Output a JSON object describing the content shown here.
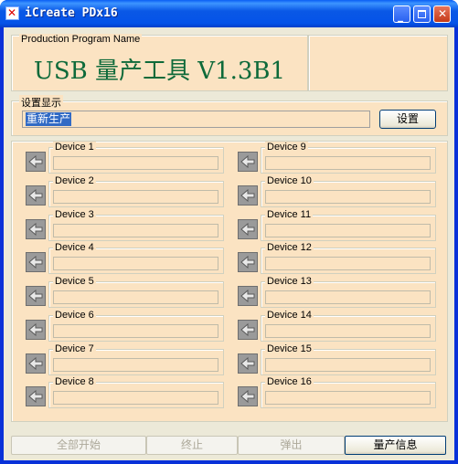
{
  "window": {
    "title": "iCreate PDx16"
  },
  "header": {
    "group_label": "Production Program Name",
    "program_name": "USB 量产工具 V1.3B1"
  },
  "settings": {
    "group_label": "设置显示",
    "status_text": "重新生产",
    "settings_button": "设置"
  },
  "devices_left": [
    {
      "label": "Device 1"
    },
    {
      "label": "Device 2"
    },
    {
      "label": "Device 3"
    },
    {
      "label": "Device 4"
    },
    {
      "label": "Device 5"
    },
    {
      "label": "Device 6"
    },
    {
      "label": "Device 7"
    },
    {
      "label": "Device 8"
    }
  ],
  "devices_right": [
    {
      "label": "Device 9"
    },
    {
      "label": "Device 10"
    },
    {
      "label": "Device 11"
    },
    {
      "label": "Device 12"
    },
    {
      "label": "Device 13"
    },
    {
      "label": "Device 14"
    },
    {
      "label": "Device 15"
    },
    {
      "label": "Device 16"
    }
  ],
  "bottom_buttons": {
    "start_all": "全部开始",
    "stop": "终止",
    "eject": "弹出",
    "production_info": "量产信息"
  },
  "icons": {
    "app": "icreate-app-icon",
    "device": "arrow-left-icon"
  }
}
